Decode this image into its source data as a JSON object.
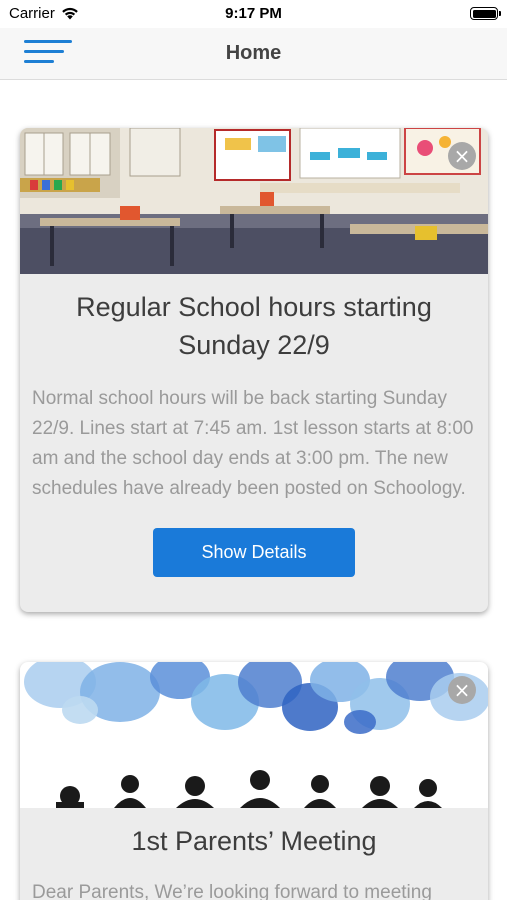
{
  "status_bar": {
    "carrier": "Carrier",
    "time": "9:17 PM",
    "wifi_icon": "wifi-icon",
    "battery_icon": "battery-icon"
  },
  "nav": {
    "menu_icon": "hamburger-menu-icon",
    "title": "Home",
    "accent_color": "#1e7fd4"
  },
  "cards": [
    {
      "image": "classroom-photo",
      "close_icon": "close-icon",
      "title": "Regular School hours starting Sunday 22/9",
      "body": "Normal school hours will be back starting Sunday 22/9. Lines start at 7:45 am. 1st lesson starts at 8:00 am and the school day ends at 3:00 pm. The new schedules have already been posted on Schoology.",
      "button_label": "Show Details",
      "button_color": "#1a7ad9"
    },
    {
      "image": "speech-bubbles-people-illustration",
      "close_icon": "close-icon",
      "title": "1st Parents’ Meeting",
      "body": "Dear Parents, We’re looking forward to meeting"
    }
  ]
}
